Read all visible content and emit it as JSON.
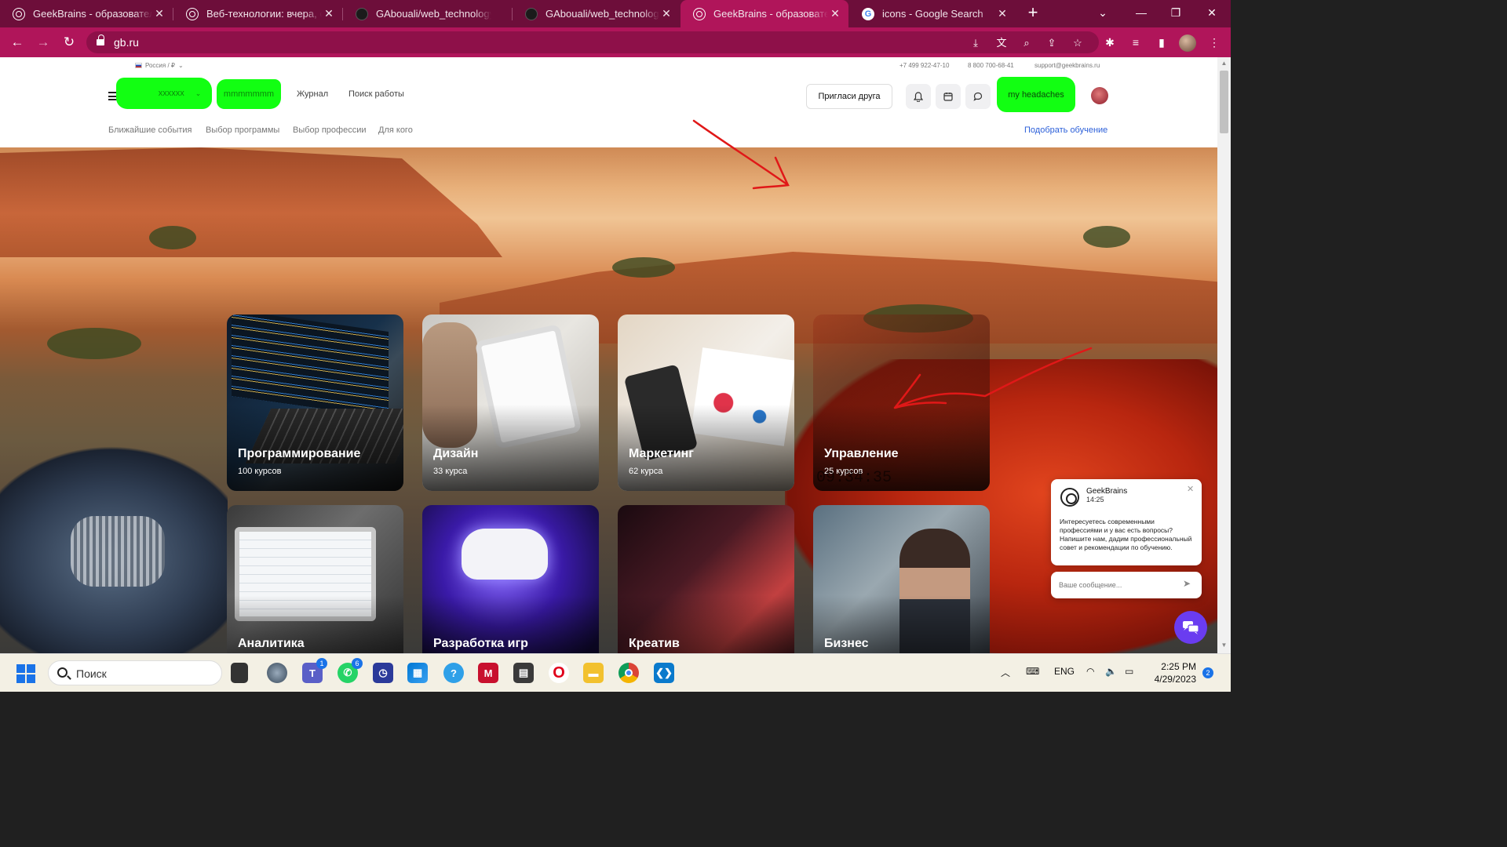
{
  "browser": {
    "tabs": [
      {
        "title": "GeekBrains - образовательная",
        "icon": "geekbrains-icon"
      },
      {
        "title": "Веб-технологии: вчера, сегодня",
        "icon": "geekbrains-icon"
      },
      {
        "title": "GAbouali/web_technology",
        "icon": "github-icon"
      },
      {
        "title": "GAbouali/web_technology",
        "icon": "github-icon"
      },
      {
        "title": "GeekBrains - образовательная",
        "icon": "geekbrains-icon",
        "active": true
      },
      {
        "title": "icons - Google Search",
        "icon": "google-icon"
      }
    ],
    "url": "gb.ru"
  },
  "site": {
    "region": "Россия / ₽",
    "phone1": "+7 499 922-47-10",
    "phone2": "8 800 700-68-41",
    "email": "support@geekbrains.ru",
    "green1": "xxxxxx",
    "green2": "mmmmmmm",
    "nav": [
      "Журнал",
      "Поиск работы"
    ],
    "invite": "Пригласи друга",
    "user_button": "my headaches",
    "subnav": [
      "Ближайшие события",
      "Выбор программы",
      "Выбор профессии",
      "Для кого"
    ],
    "pick": "Подобрать обучение"
  },
  "categories": [
    {
      "title": "Программирование",
      "count": "100 курсов"
    },
    {
      "title": "Дизайн",
      "count": "33 курса"
    },
    {
      "title": "Маркетинг",
      "count": "62 курса"
    },
    {
      "title": "Управление",
      "count": "25 курсов"
    },
    {
      "title": "Аналитика"
    },
    {
      "title": "Разработка игр"
    },
    {
      "title": "Креатив"
    },
    {
      "title": "Бизнес"
    }
  ],
  "watermark": "09:34:35",
  "chat": {
    "name": "GeekBrains",
    "time": "14:25",
    "message": "Интересуетесь современными профессиями и у вас есть вопросы? Напишите нам, дадим профессиональный совет и рекомендации по обучению.",
    "placeholder": "Ваше сообщение..."
  },
  "taskbar": {
    "search": "Поиск",
    "lang": "ENG",
    "time": "2:25 PM",
    "date": "4/29/2023",
    "notifications": "2",
    "badges": {
      "teams": "1",
      "whatsapp": "6"
    }
  },
  "colors": {
    "tabbar": "#6d0e3a",
    "toolbar": "#b0155a",
    "highlight_green": "#12ff12",
    "link_blue": "#2b5fd9",
    "arrow_red": "#e01818"
  }
}
